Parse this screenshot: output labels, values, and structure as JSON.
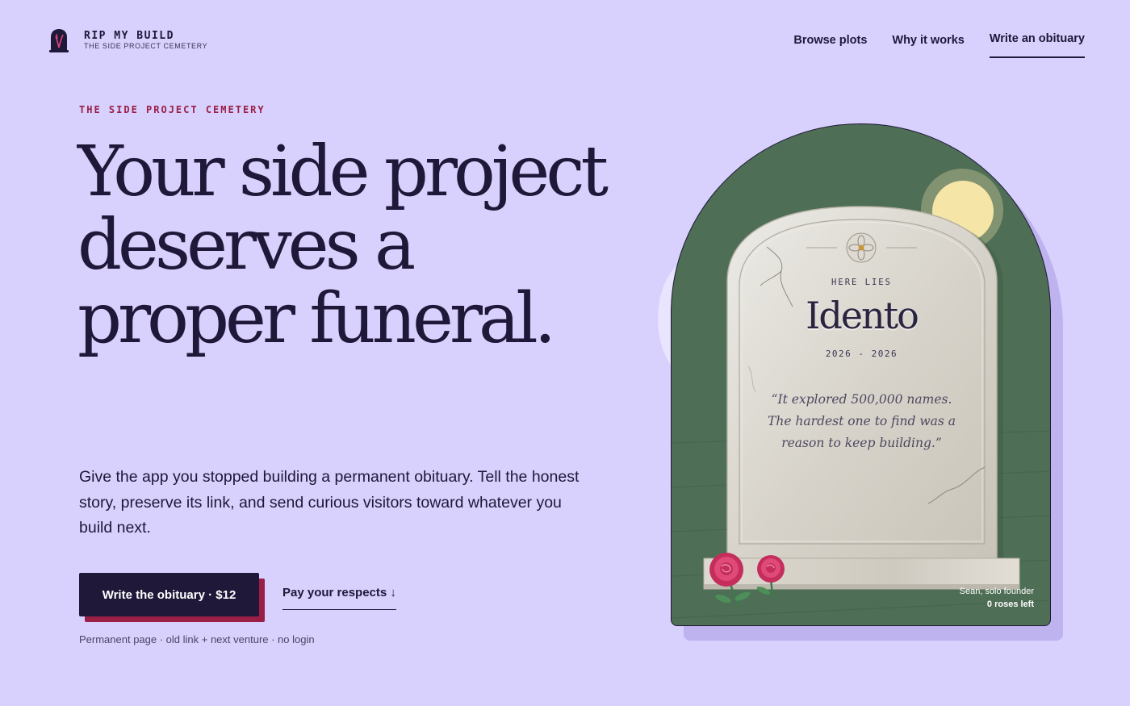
{
  "brand": {
    "title": "RIP MY BUILD",
    "subtitle": "THE SIDE PROJECT CEMETERY",
    "logo_icon": "tombstone-icon"
  },
  "nav": {
    "items": [
      {
        "label": "Browse plots",
        "active": false
      },
      {
        "label": "Why it works",
        "active": false
      },
      {
        "label": "Write an obituary",
        "active": true
      }
    ]
  },
  "hero": {
    "eyebrow": "THE SIDE PROJECT CEMETERY",
    "headline": "Your side project deserves a proper funeral.",
    "lede": "Give the app you stopped building a permanent obituary. Tell the honest story, preserve its link, and send curious visitors toward whatever you build next.",
    "cta_label": "Write the obituary · $12",
    "secondary_label": "Pay your respects ↓",
    "fine_print": "Permanent page · old link + next venture · no login"
  },
  "tombstone": {
    "here_lies": "HERE LIES",
    "name": "Idento",
    "years": "2026 - 2026",
    "epitaph": "“It explored 500,000 names. The hardest one to find was a reason to keep building.”",
    "author": "Sean, solo founder",
    "roses": "0 roses left"
  },
  "colors": {
    "background": "#d8d0fd",
    "ink": "#1f1838",
    "accent": "#9a1f47",
    "grass": "#4e6e55",
    "moon": "#f5e6a8",
    "stone": "#d9d5cc",
    "rose": "#d9406e"
  }
}
